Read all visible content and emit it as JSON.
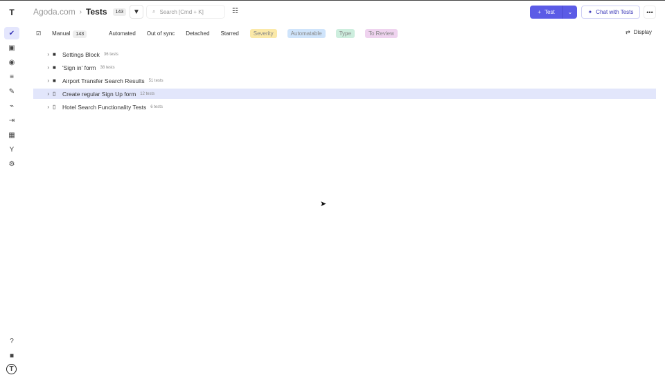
{
  "sidebar": {
    "items": [
      {
        "name": "tests",
        "glyph": "✔",
        "active": true
      },
      {
        "name": "runs",
        "glyph": "▣"
      },
      {
        "name": "play",
        "glyph": "◉"
      },
      {
        "name": "plans",
        "glyph": "≡"
      },
      {
        "name": "edit",
        "glyph": "✎"
      },
      {
        "name": "activity",
        "glyph": "⌁"
      },
      {
        "name": "import",
        "glyph": "⇥"
      },
      {
        "name": "analytics",
        "glyph": "▦"
      },
      {
        "name": "branches",
        "glyph": "Y"
      },
      {
        "name": "settings",
        "glyph": "⚙"
      }
    ],
    "bottom": [
      {
        "name": "help",
        "glyph": "?"
      },
      {
        "name": "projects",
        "glyph": "■"
      },
      {
        "name": "logo",
        "glyph": "T"
      }
    ]
  },
  "header": {
    "logo": "T",
    "project": "Agoda.com",
    "separator": "›",
    "title": "Tests",
    "count": "143",
    "search_placeholder": "Search [Cmd + K]",
    "new_test": "Test",
    "chat": "Chat with Tests",
    "more": "•••"
  },
  "filters": {
    "manual": "Manual",
    "manual_count": "143",
    "automated": "Automated",
    "out_of_sync": "Out of sync",
    "detached": "Detached",
    "starred": "Starred",
    "pills": [
      {
        "label": "Severity",
        "bg": "#fbe9a8"
      },
      {
        "label": "Automatable",
        "bg": "#cfe4fb"
      },
      {
        "label": "Type",
        "bg": "#cdeede"
      },
      {
        "label": "To Review",
        "bg": "#efd3ef"
      }
    ],
    "display": "Display"
  },
  "tree": [
    {
      "type": "folder",
      "name": "Settings Block",
      "count": "36 tests"
    },
    {
      "type": "folder",
      "name": "'Sign in' form",
      "count": "38 tests"
    },
    {
      "type": "folder",
      "name": "Airport Transfer Search Results",
      "count": "51 tests"
    },
    {
      "type": "suite",
      "name": "Create regular Sign Up form",
      "count": "12 tests",
      "selected": true
    },
    {
      "type": "suite",
      "name": "Hotel Search Functionality Tests",
      "count": "6 tests"
    }
  ]
}
